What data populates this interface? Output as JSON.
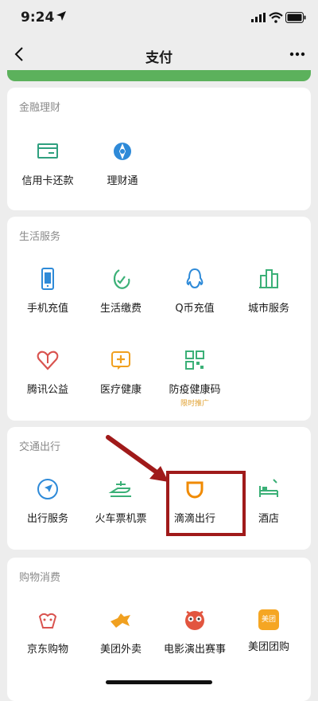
{
  "status": {
    "time": "9:24"
  },
  "nav": {
    "title": "支付"
  },
  "sections": [
    {
      "title": "金融理财",
      "items": [
        {
          "label": "信用卡还款",
          "icon": "credit-card-icon"
        },
        {
          "label": "理财通",
          "icon": "wealth-icon"
        }
      ]
    },
    {
      "title": "生活服务",
      "items": [
        {
          "label": "手机充值",
          "icon": "phone-topup-icon"
        },
        {
          "label": "生活缴费",
          "icon": "utility-icon"
        },
        {
          "label": "Q币充值",
          "icon": "qq-coin-icon"
        },
        {
          "label": "城市服务",
          "icon": "city-service-icon"
        },
        {
          "label": "腾讯公益",
          "icon": "charity-icon"
        },
        {
          "label": "医疗健康",
          "icon": "medical-icon"
        },
        {
          "label": "防疫健康码",
          "icon": "qr-health-code-icon",
          "sub": "限时推广"
        }
      ]
    },
    {
      "title": "交通出行",
      "items": [
        {
          "label": "出行服务",
          "icon": "navigation-icon"
        },
        {
          "label": "火车票机票",
          "icon": "train-plane-icon"
        },
        {
          "label": "滴滴出行",
          "icon": "didi-icon"
        },
        {
          "label": "酒店",
          "icon": "hotel-icon"
        }
      ]
    },
    {
      "title": "购物消费",
      "items": [
        {
          "label": "京东购物",
          "icon": "jd-icon"
        },
        {
          "label": "美团外卖",
          "icon": "meituan-waimai-icon"
        },
        {
          "label": "电影演出赛事",
          "icon": "movie-icon"
        },
        {
          "label": "美团团购",
          "icon": "meituan-tuangou-icon",
          "badge": "美团"
        }
      ]
    }
  ],
  "colors": {
    "accent": "#07c160",
    "highlight": "#a01a1a"
  }
}
